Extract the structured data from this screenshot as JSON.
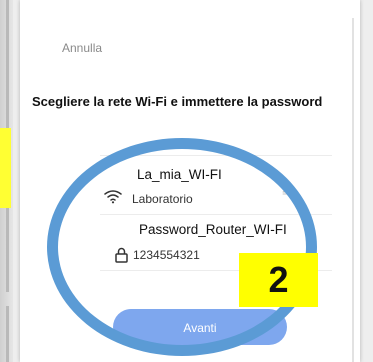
{
  "header": {
    "cancel_label": "Annulla"
  },
  "page": {
    "title": "Scegliere la rete Wi-Fi e immettere la password"
  },
  "wifi": {
    "callout_label": "La_mia_WI-FI",
    "network_value": "Laboratorio",
    "icon": "wifi-icon",
    "switch_icon": "swap-icon"
  },
  "password": {
    "callout_label": "Password_Router_WI-FI",
    "value": "1234554321",
    "icon": "lock-icon"
  },
  "actions": {
    "next_label": "Avanti"
  },
  "annotation": {
    "step_number": "2",
    "circle_color": "#5b9bd5",
    "badge_color": "#ffff00"
  },
  "colors": {
    "button": "#7ea7ee"
  }
}
